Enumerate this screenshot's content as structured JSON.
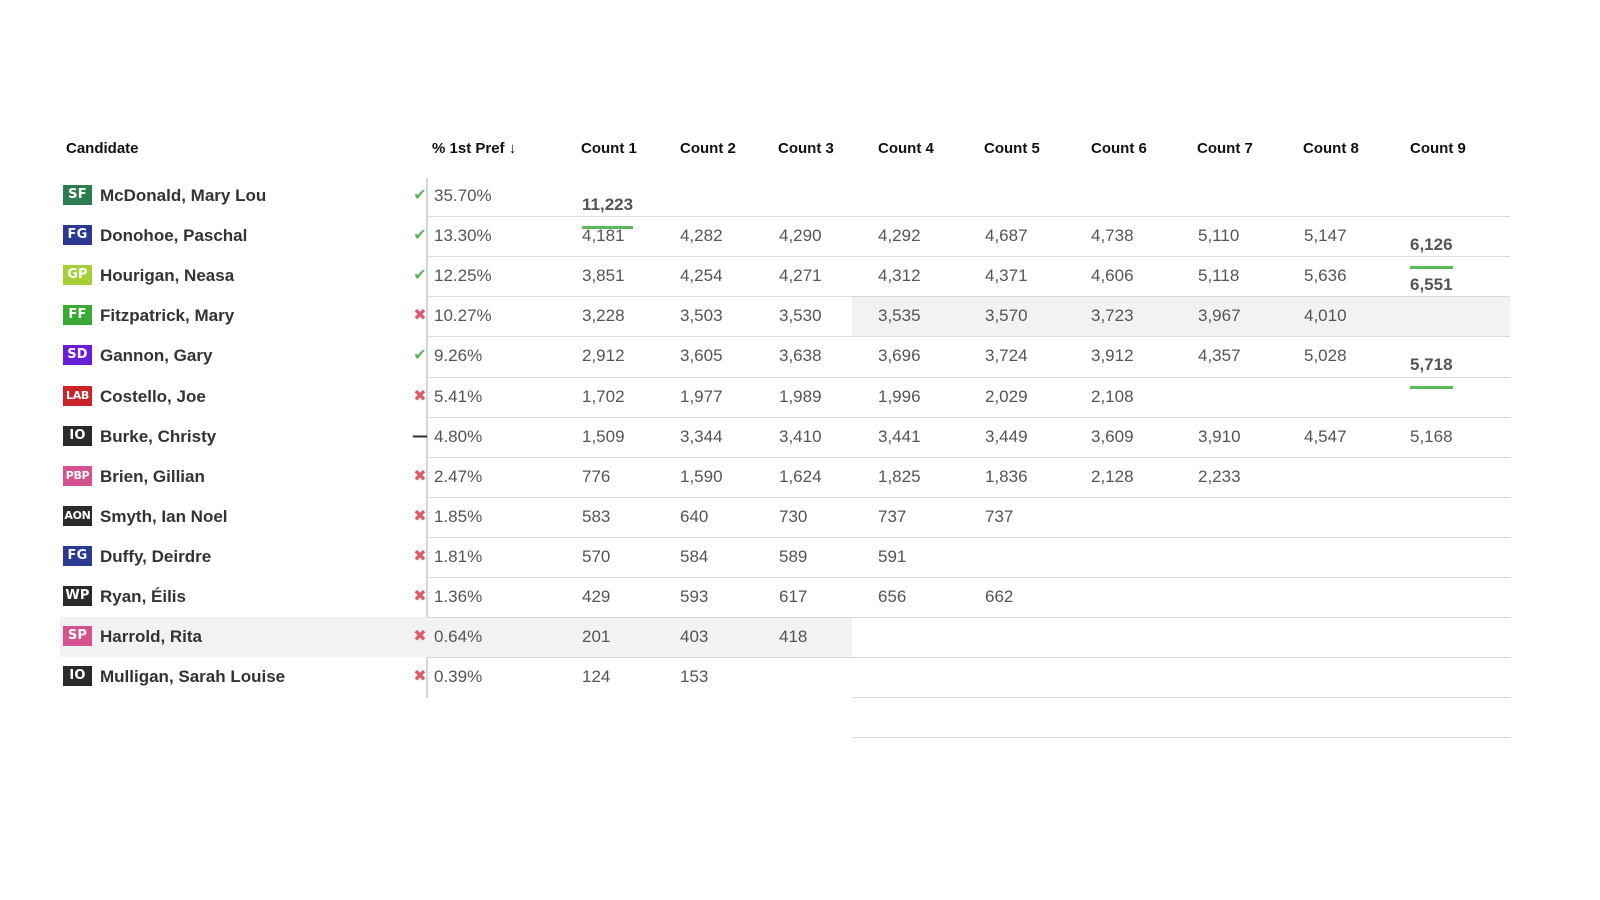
{
  "table": {
    "headers": {
      "candidate": "Candidate",
      "first_pref": "% 1st Pref ↓",
      "counts": [
        "Count 1",
        "Count 2",
        "Count 3",
        "Count 4",
        "Count 5",
        "Count 6",
        "Count 7",
        "Count 8",
        "Count 9"
      ]
    },
    "rows": [
      {
        "party": "SF",
        "party_color": "#2e7d4f",
        "name": "McDonald, Mary Lou",
        "status": "elected",
        "pct": "35.70%",
        "counts": [
          "11,223",
          "",
          "",
          "",
          "",
          "",
          "",
          "",
          ""
        ]
      },
      {
        "party": "FG",
        "party_color": "#2b3990",
        "name": "Donohoe, Paschal",
        "status": "elected",
        "pct": "13.30%",
        "counts": [
          "4,181",
          "4,282",
          "4,290",
          "4,292",
          "4,687",
          "4,738",
          "5,110",
          "5,147",
          "6,126"
        ]
      },
      {
        "party": "GP",
        "party_color": "#a6ce39",
        "name": "Hourigan, Neasa",
        "status": "elected",
        "pct": "12.25%",
        "counts": [
          "3,851",
          "4,254",
          "4,271",
          "4,312",
          "4,371",
          "4,606",
          "5,118",
          "5,636",
          "6,551"
        ]
      },
      {
        "party": "FF",
        "party_color": "#3aaa35",
        "name": "Fitzpatrick, Mary",
        "status": "eliminated",
        "pct": "10.27%",
        "counts": [
          "3,228",
          "3,503",
          "3,530",
          "3,535",
          "3,570",
          "3,723",
          "3,967",
          "4,010",
          ""
        ]
      },
      {
        "party": "SD",
        "party_color": "#6a1ed8",
        "name": "Gannon, Gary",
        "status": "elected",
        "pct": "9.26%",
        "counts": [
          "2,912",
          "3,605",
          "3,638",
          "3,696",
          "3,724",
          "3,912",
          "4,357",
          "5,028",
          "5,718"
        ]
      },
      {
        "party": "LAB",
        "party_color": "#cc2229",
        "name": "Costello, Joe",
        "status": "eliminated",
        "pct": "5.41%",
        "counts": [
          "1,702",
          "1,977",
          "1,989",
          "1,996",
          "2,029",
          "2,108",
          "",
          "",
          ""
        ]
      },
      {
        "party": "IO",
        "party_color": "#2b2b2b",
        "name": "Burke, Christy",
        "status": "neutral",
        "pct": "4.80%",
        "counts": [
          "1,509",
          "3,344",
          "3,410",
          "3,441",
          "3,449",
          "3,609",
          "3,910",
          "4,547",
          "5,168"
        ]
      },
      {
        "party": "PBP",
        "party_color": "#d4528f",
        "name": "Brien, Gillian",
        "status": "eliminated",
        "pct": "2.47%",
        "counts": [
          "776",
          "1,590",
          "1,624",
          "1,825",
          "1,836",
          "2,128",
          "2,233",
          "",
          ""
        ]
      },
      {
        "party": "AON",
        "party_color": "#2b2b2b",
        "name": "Smyth, Ian Noel",
        "status": "eliminated",
        "pct": "1.85%",
        "counts": [
          "583",
          "640",
          "730",
          "737",
          "737",
          "",
          "",
          "",
          ""
        ]
      },
      {
        "party": "FG",
        "party_color": "#2b3990",
        "name": "Duffy, Deirdre",
        "status": "eliminated",
        "pct": "1.81%",
        "counts": [
          "570",
          "584",
          "589",
          "591",
          "",
          "",
          "",
          "",
          ""
        ]
      },
      {
        "party": "WP",
        "party_color": "#2b2b2b",
        "name": "Ryan, Éilis",
        "status": "eliminated",
        "pct": "1.36%",
        "counts": [
          "429",
          "593",
          "617",
          "656",
          "662",
          "",
          "",
          "",
          ""
        ]
      },
      {
        "party": "SP",
        "party_color": "#d4528f",
        "name": "Harrold, Rita",
        "status": "eliminated",
        "pct": "0.64%",
        "counts": [
          "201",
          "403",
          "418",
          "",
          "",
          "",
          "",
          "",
          ""
        ]
      },
      {
        "party": "IO",
        "party_color": "#2b2b2b",
        "name": "Mulligan, Sarah Louise",
        "status": "eliminated",
        "pct": "0.39%",
        "counts": [
          "124",
          "153",
          "",
          "",
          "",
          "",
          "",
          "",
          ""
        ]
      }
    ],
    "status_icons": {
      "elected": "✔",
      "eliminated": "✖",
      "neutral": "—"
    },
    "status_icon_names": {
      "elected": "check-icon",
      "eliminated": "cross-icon",
      "neutral": "dash-icon"
    }
  }
}
